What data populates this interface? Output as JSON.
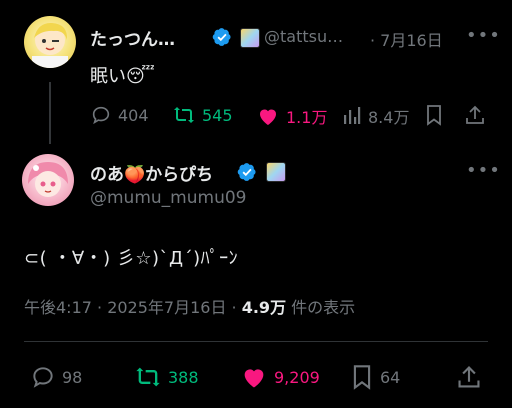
{
  "tweet1": {
    "display_name": "たっつん…",
    "handle": "@tattsu…",
    "date": "· 7月16日",
    "text": "眠い",
    "emoji": "😴",
    "actions": {
      "replies": "404",
      "retweets": "545",
      "likes": "1.1万",
      "views": "8.4万"
    }
  },
  "tweet2": {
    "display_name": "のあ",
    "display_name_emoji": "🍑",
    "display_name_rest": "からぴち",
    "handle": "@mumu_mumu09",
    "text": "⊂( ・∀・) 彡☆)`Д´)ﾊﾟｰﾝ",
    "meta": {
      "time": "午後4:17 · 2025年7月16日 ·",
      "views_count": "4.9万",
      "views_label": "件の表示"
    },
    "actions": {
      "replies": "98",
      "retweets": "388",
      "likes": "9,209",
      "bookmarks": "64"
    }
  },
  "colors": {
    "background": "#000000",
    "text": "#e7e9ea",
    "muted": "#71767b",
    "verified": "#1d9bf0",
    "retweet": "#00ba7c",
    "like": "#f91880",
    "divider": "#2f3336"
  }
}
